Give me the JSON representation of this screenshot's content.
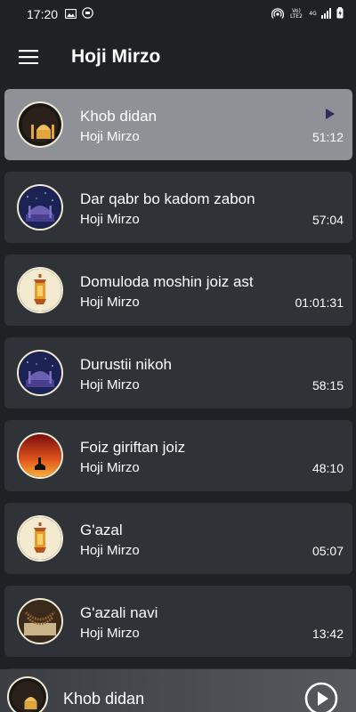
{
  "status_bar": {
    "time": "17:20",
    "icons": [
      "image-icon",
      "app-badge-icon"
    ],
    "right_icons": [
      "hotspot-icon",
      "volte-icon",
      "signal-4g-icon",
      "signal-bars-icon",
      "battery-charging-icon"
    ],
    "volte_label": "Vo)\nLTE2",
    "net_label": "4G"
  },
  "app_bar": {
    "menu_icon": "hamburger-menu-icon",
    "title": "Hoji Mirzo"
  },
  "tracks": [
    {
      "title": "Khob didan",
      "artist": "Hoji Mirzo",
      "duration": "51:12",
      "art": "mosque-moon-icon",
      "active": true
    },
    {
      "title": "Dar qabr bo kadom zabon",
      "artist": "Hoji Mirzo",
      "duration": "57:04",
      "art": "night-mosque-icon",
      "active": false
    },
    {
      "title": "Domuloda moshin joiz ast",
      "artist": "Hoji Mirzo",
      "duration": "01:01:31",
      "art": "lantern-icon",
      "active": false
    },
    {
      "title": "Durustii nikoh",
      "artist": "Hoji Mirzo",
      "duration": "58:15",
      "art": "night-mosque-icon",
      "active": false
    },
    {
      "title": "Foiz giriftan joiz",
      "artist": "Hoji Mirzo",
      "duration": "48:10",
      "art": "sunset-crescent-icon",
      "active": false
    },
    {
      "title": "G'azal",
      "artist": "Hoji Mirzo",
      "duration": "05:07",
      "art": "lantern-icon",
      "active": false
    },
    {
      "title": "G'azali navi",
      "artist": "Hoji Mirzo",
      "duration": "13:42",
      "art": "prayer-beads-icon",
      "active": false
    }
  ],
  "player": {
    "title": "Khob didan",
    "art": "mosque-moon-icon",
    "play_icon": "play-circle-icon"
  },
  "colors": {
    "background": "#202124",
    "card": "#2f3236",
    "card_active": "#8e9297",
    "play_accent": "#2d2a66"
  }
}
